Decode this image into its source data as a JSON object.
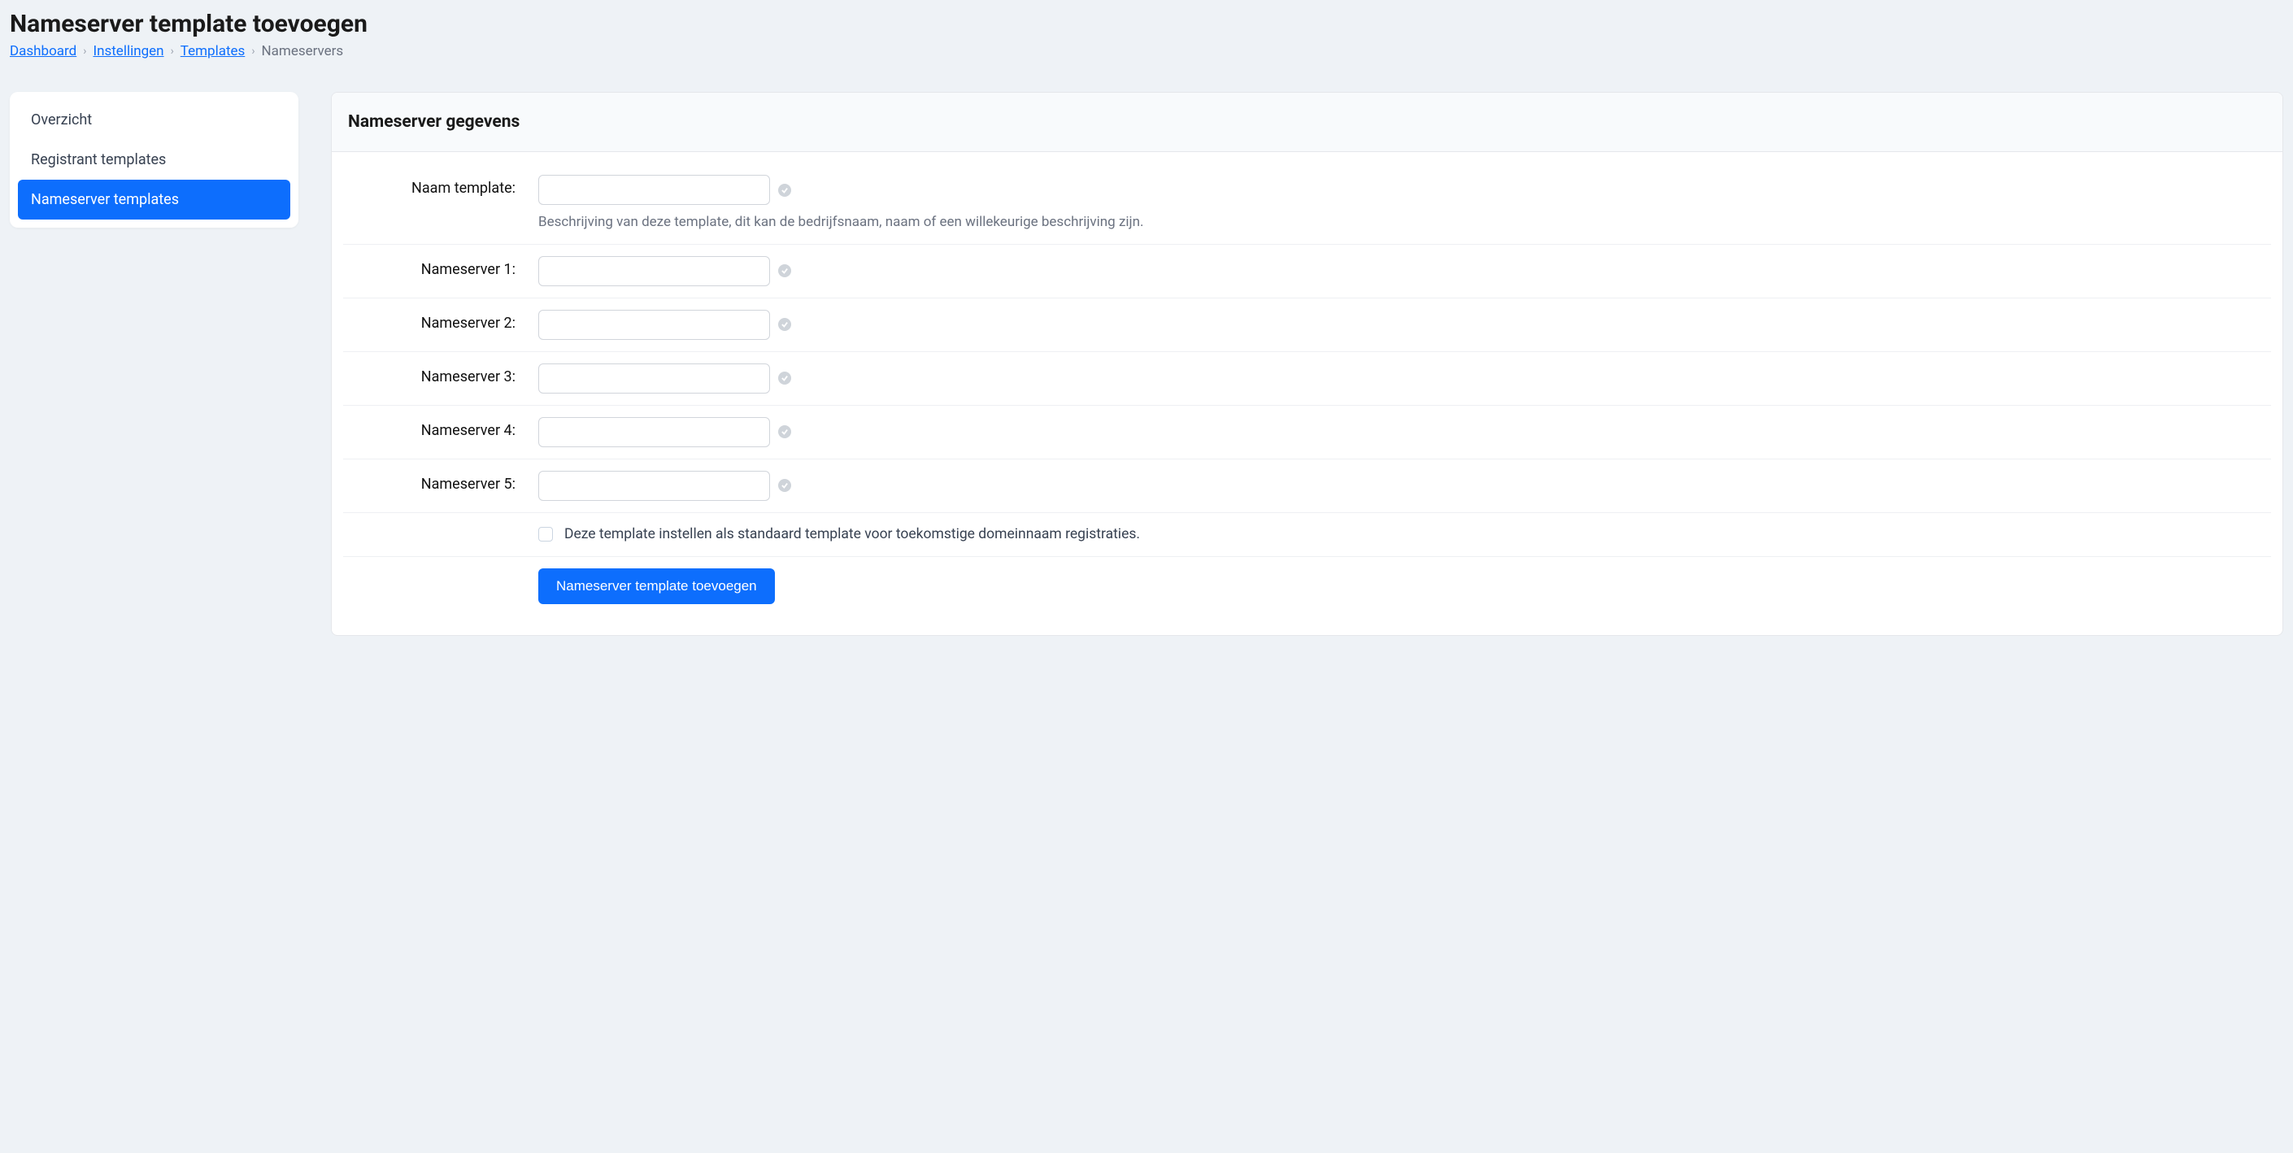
{
  "header": {
    "title": "Nameserver template toevoegen"
  },
  "breadcrumb": {
    "items": [
      {
        "label": "Dashboard",
        "link": true
      },
      {
        "label": "Instellingen",
        "link": true
      },
      {
        "label": "Templates",
        "link": true
      },
      {
        "label": "Nameservers",
        "link": false
      }
    ]
  },
  "sidebar": {
    "items": [
      {
        "label": "Overzicht",
        "active": false
      },
      {
        "label": "Registrant templates",
        "active": false
      },
      {
        "label": "Nameserver templates",
        "active": true
      }
    ]
  },
  "panel": {
    "title": "Nameserver gegevens"
  },
  "form": {
    "name_template_label": "Naam template:",
    "name_template_value": "",
    "name_template_helper": "Beschrijving van deze template, dit kan de bedrijfsnaam, naam of een willekeurige beschrijving zijn.",
    "nameserver1_label": "Nameserver 1:",
    "nameserver1_value": "",
    "nameserver2_label": "Nameserver 2:",
    "nameserver2_value": "",
    "nameserver3_label": "Nameserver 3:",
    "nameserver3_value": "",
    "nameserver4_label": "Nameserver 4:",
    "nameserver4_value": "",
    "nameserver5_label": "Nameserver 5:",
    "nameserver5_value": "",
    "default_checkbox_label": "Deze template instellen als standaard template voor toekomstige domeinnaam registraties.",
    "default_checkbox_checked": false,
    "submit_label": "Nameserver template toevoegen"
  }
}
